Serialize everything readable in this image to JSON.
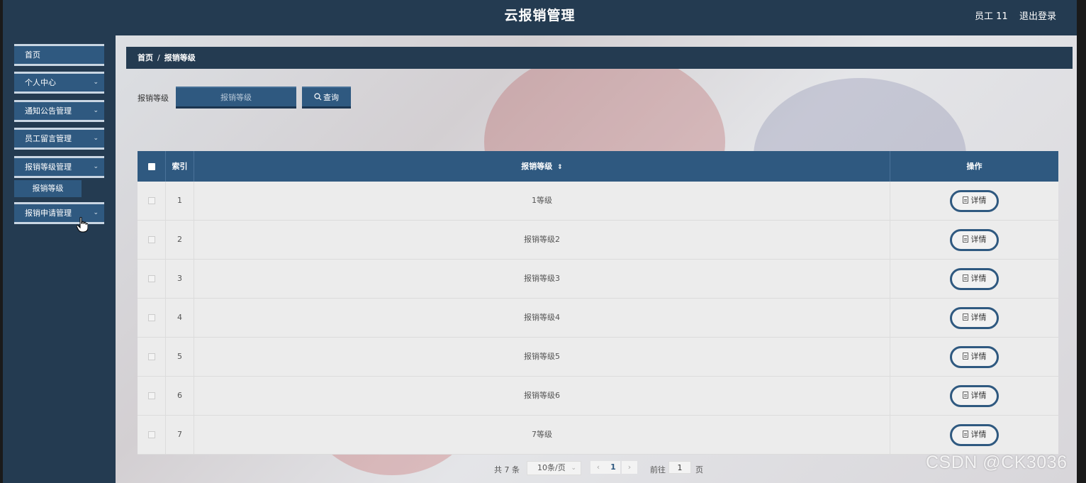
{
  "header": {
    "title": "云报销管理",
    "user": "员工 11",
    "logout": "退出登录"
  },
  "sidebar": {
    "items": [
      {
        "label": "首页"
      },
      {
        "label": "个人中心"
      },
      {
        "label": "通知公告管理"
      },
      {
        "label": "员工留言管理"
      },
      {
        "label": "报销等级管理"
      },
      {
        "label": "报销申请管理"
      }
    ],
    "submenu": {
      "label": "报销等级"
    }
  },
  "breadcrumb": {
    "home": "首页",
    "separator": "/",
    "current": "报销等级"
  },
  "search": {
    "label": "报销等级",
    "placeholder": "报销等级",
    "button": "查询",
    "button_icon": "search-icon"
  },
  "table": {
    "columns": {
      "index": "索引",
      "level": "报销等级",
      "actions": "操作"
    },
    "sort_icon": "sort-icon",
    "rows": [
      {
        "index": "1",
        "level": "1等级",
        "action": "详情"
      },
      {
        "index": "2",
        "level": "报销等级2",
        "action": "详情"
      },
      {
        "index": "3",
        "level": "报销等级3",
        "action": "详情"
      },
      {
        "index": "4",
        "level": "报销等级4",
        "action": "详情"
      },
      {
        "index": "5",
        "level": "报销等级5",
        "action": "详情"
      },
      {
        "index": "6",
        "level": "报销等级6",
        "action": "详情"
      },
      {
        "index": "7",
        "level": "7等级",
        "action": "详情"
      }
    ]
  },
  "pagination": {
    "total": "共 7 条",
    "page_size": "10条/页",
    "current_page": "1",
    "goto_label": "前往",
    "goto_value": "1",
    "page_suffix": "页"
  },
  "watermark": "CSDN @CK3036",
  "colors": {
    "header_bg": "#243b51",
    "accent": "#2f5980",
    "table_bg": "#ececec"
  }
}
